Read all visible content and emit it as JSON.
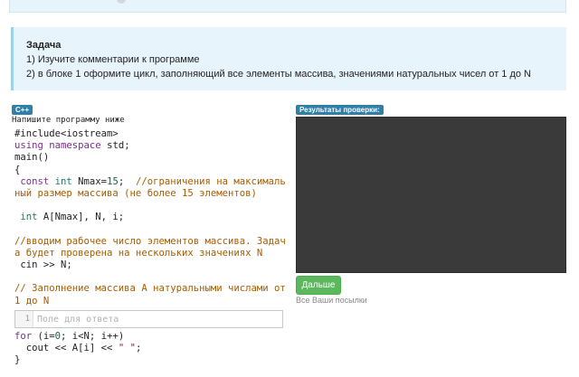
{
  "task": {
    "title": "Задача",
    "line1": "1) Изучите комментарии к программе",
    "line2": "2) в блоке 1 оформите цикл, заполняющий все элементы массива, значениями натуральных чисел от 1 до N"
  },
  "editor": {
    "language_badge": "C++",
    "prompt": "Напишите программу ниже",
    "code_lines": [
      {
        "parts": [
          {
            "t": "#include<iostream>",
            "c": ""
          }
        ]
      },
      {
        "parts": [
          {
            "t": "using namespace ",
            "c": "kw"
          },
          {
            "t": "std;",
            "c": ""
          }
        ]
      },
      {
        "parts": [
          {
            "t": "main()",
            "c": ""
          }
        ]
      },
      {
        "parts": [
          {
            "t": "{",
            "c": ""
          }
        ]
      },
      {
        "parts": [
          {
            "t": " const ",
            "c": "kw"
          },
          {
            "t": "int ",
            "c": "ty"
          },
          {
            "t": "Nmax=",
            "c": ""
          },
          {
            "t": "15",
            "c": "num"
          },
          {
            "t": ";  ",
            "c": ""
          },
          {
            "t": "//ограничения на максималь",
            "c": "cm"
          }
        ]
      },
      {
        "parts": [
          {
            "t": "ный размер массива (не более 15 элементов)",
            "c": "cm"
          }
        ]
      },
      {
        "parts": [
          {
            "t": "",
            "c": ""
          }
        ]
      },
      {
        "parts": [
          {
            "t": " int ",
            "c": "ty"
          },
          {
            "t": "A[Nmax], N, i;",
            "c": ""
          }
        ]
      },
      {
        "parts": [
          {
            "t": "",
            "c": ""
          }
        ]
      },
      {
        "parts": [
          {
            "t": "//вводим рабочее число элементов массива. Задач",
            "c": "cm"
          }
        ]
      },
      {
        "parts": [
          {
            "t": "а будет проверена на нескольких значениях N",
            "c": "cm"
          }
        ]
      },
      {
        "parts": [
          {
            "t": " cin >> N;",
            "c": ""
          }
        ]
      },
      {
        "parts": [
          {
            "t": "",
            "c": ""
          }
        ]
      },
      {
        "parts": [
          {
            "t": "// Заполнение массива А натуральными числами от",
            "c": "cm"
          }
        ]
      },
      {
        "parts": [
          {
            "t": "1 до N",
            "c": "cm"
          }
        ]
      }
    ],
    "answer_line_number": "1",
    "answer_placeholder": "Поле для ответа",
    "code_lines_after": [
      {
        "parts": [
          {
            "t": "for ",
            "c": "kw"
          },
          {
            "t": "(i=",
            "c": ""
          },
          {
            "t": "0",
            "c": "num"
          },
          {
            "t": "; i<N; i++)",
            "c": ""
          }
        ]
      },
      {
        "parts": [
          {
            "t": "  cout << A[i] << ",
            "c": ""
          },
          {
            "t": "\" \"",
            "c": "str"
          },
          {
            "t": ";",
            "c": ""
          }
        ]
      },
      {
        "parts": [
          {
            "t": "}",
            "c": ""
          }
        ]
      }
    ]
  },
  "results": {
    "badge": "Результаты проверки:",
    "next_button": "Дальше",
    "all_submissions_link": "Все Ваши посылки"
  }
}
